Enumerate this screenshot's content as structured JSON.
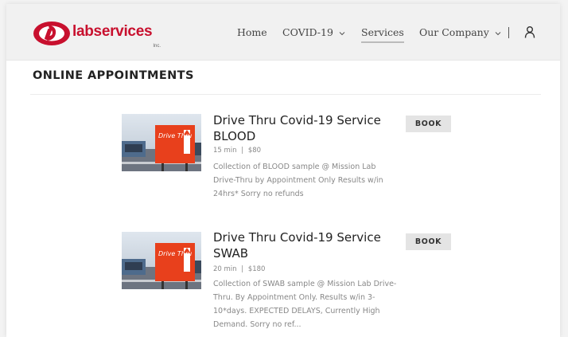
{
  "brand": {
    "name": "labservices",
    "suffix": "Inc.",
    "accent_color": "#c8102e"
  },
  "nav": {
    "items": [
      {
        "label": "Home",
        "has_dropdown": false,
        "active": false
      },
      {
        "label": "COVID-19",
        "has_dropdown": true,
        "active": false
      },
      {
        "label": "Services",
        "has_dropdown": false,
        "active": true
      },
      {
        "label": "Our Company",
        "has_dropdown": true,
        "active": false
      }
    ],
    "separator": "|",
    "account_icon": "user-icon"
  },
  "page": {
    "title": "ONLINE APPOINTMENTS"
  },
  "services": [
    {
      "name": "Drive Thru Covid-19 Service BLOOD",
      "duration": "15 min",
      "separator": "|",
      "price": "$80",
      "description": "Collection of BLOOD sample @ Mission Lab Drive-Thru by Appointment Only Results w/in 24hrs* Sorry no refunds",
      "book_label": "BOOK",
      "image_sign_text": "Drive Thru"
    },
    {
      "name": "Drive Thru Covid-19 Service SWAB",
      "duration": "20 min",
      "separator": "|",
      "price": "$180",
      "description": "Collection of SWAB sample @ Mission Lab Drive-Thru. By Appointment Only. Results w/in 3-10*days. EXPECTED DELAYS, Currently High Demand. Sorry no ref...",
      "book_label": "BOOK",
      "image_sign_text": "Drive Thru"
    }
  ]
}
